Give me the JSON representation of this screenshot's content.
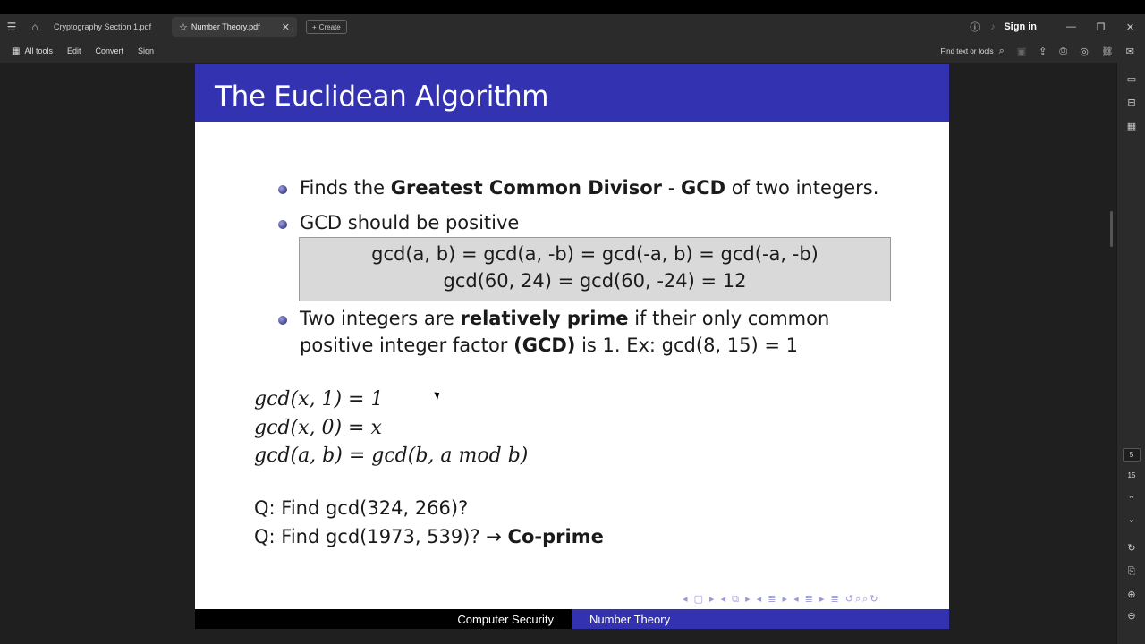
{
  "tabs": [
    {
      "label": "Cryptography Section 1.pdf"
    },
    {
      "label": "Number Theory.pdf"
    }
  ],
  "create_label": "Create",
  "sign_in": "Sign in",
  "toolbar": {
    "all_tools": "All tools",
    "edit": "Edit",
    "convert": "Convert",
    "sign": "Sign",
    "find": "Find text or tools"
  },
  "page_nav": {
    "current": "5",
    "total": "15"
  },
  "slide": {
    "title": "The Euclidean Algorithm",
    "bullet1": {
      "pre": "Finds the ",
      "b1": "Greatest Common Divisor",
      "mid": " - ",
      "b2": "GCD",
      "post": " of two integers."
    },
    "bullet2": "GCD should be positive",
    "eq1": "gcd(a, b) = gcd(a, -b) = gcd(-a, b) = gcd(-a, -b)",
    "eq2": "gcd(60, 24) = gcd(60, -24) = 12",
    "bullet3": {
      "pre": "Two integers are ",
      "b1": "relatively prime",
      "post": " if their only common",
      "line2_pre": "positive integer factor ",
      "b2": "(GCD)",
      "line2_post": " is 1.  Ex:  gcd(8, 15) = 1"
    },
    "math1": "gcd(x, 1) = 1",
    "math2": "gcd(x, 0) = x",
    "math3": "gcd(a, b) = gcd(b, a mod b)",
    "q1": "Q: Find gcd(324, 266)?",
    "q2_pre": "Q: Find gcd(1973, 539)?  → ",
    "q2_bold": "Co-prime",
    "footer_left": "Computer Security",
    "footer_right": "Number Theory"
  }
}
